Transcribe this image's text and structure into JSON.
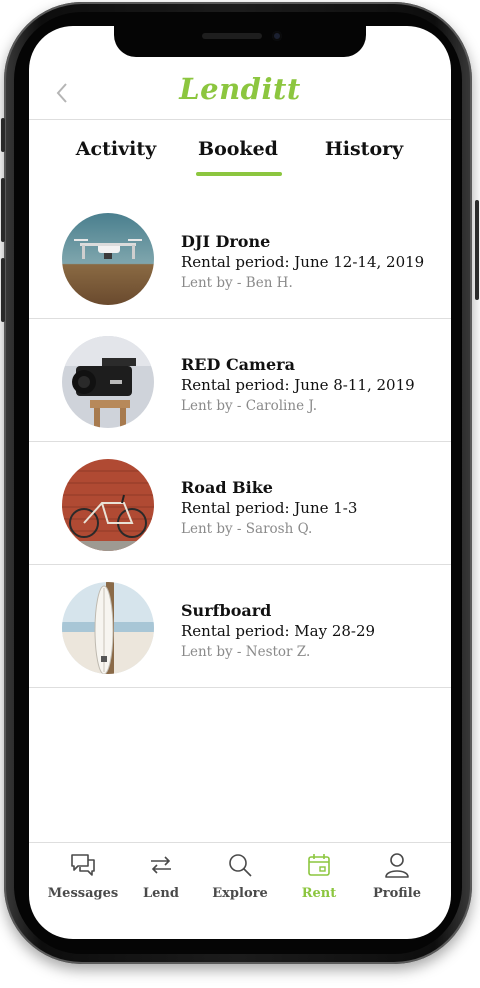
{
  "app": {
    "brand": "Lenditt"
  },
  "colors": {
    "accent": "#8cc63f",
    "text": "#111111",
    "muted": "#8a8a8a",
    "nav_inactive": "#4a4a4a"
  },
  "header": {
    "back_icon": "chevron-left-icon"
  },
  "tabs": [
    {
      "label": "Activity",
      "active": false
    },
    {
      "label": "Booked",
      "active": true
    },
    {
      "label": "History",
      "active": false
    }
  ],
  "bookings": [
    {
      "title": "DJI Drone",
      "period": "Rental period: June 12-14, 2019",
      "lender": "Lent by - Ben H.",
      "image": "drone-photo"
    },
    {
      "title": "RED Camera",
      "period": "Rental period: June 8-11, 2019",
      "lender": "Lent by - Caroline J.",
      "image": "camera-photo"
    },
    {
      "title": "Road Bike",
      "period": "Rental period: June 1-3",
      "lender": "Lent by - Sarosh Q.",
      "image": "bike-photo"
    },
    {
      "title": "Surfboard",
      "period": "Rental period: May 28-29",
      "lender": "Lent by - Nestor Z.",
      "image": "surfboard-photo"
    }
  ],
  "nav": [
    {
      "label": "Messages",
      "icon": "chat-bubbles-icon",
      "active": false
    },
    {
      "label": "Lend",
      "icon": "swap-arrows-icon",
      "active": false
    },
    {
      "label": "Explore",
      "icon": "search-icon",
      "active": false
    },
    {
      "label": "Rent",
      "icon": "calendar-icon",
      "active": true
    },
    {
      "label": "Profile",
      "icon": "user-icon",
      "active": false
    }
  ]
}
